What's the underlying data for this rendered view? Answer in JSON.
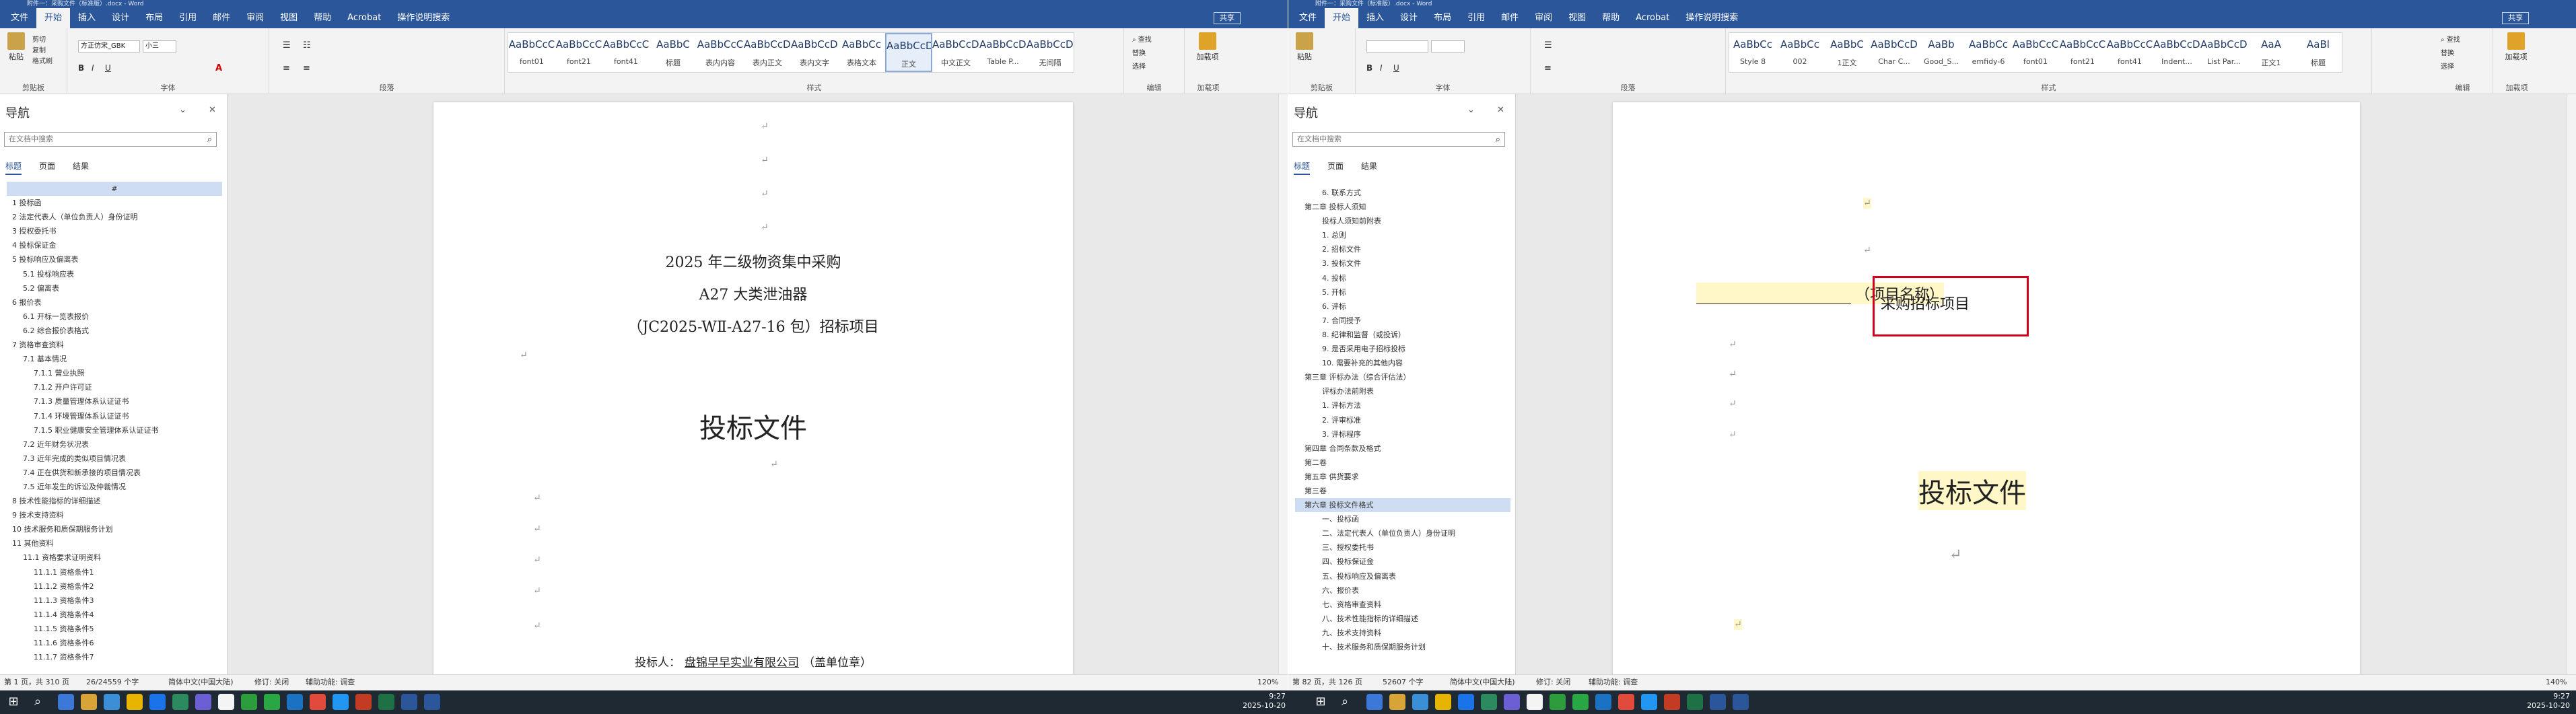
{
  "left": {
    "titlebar": {
      "title": "附件一：采购文件（标准版）.docx - Word"
    },
    "tabs": [
      "文件",
      "开始",
      "插入",
      "设计",
      "布局",
      "引用",
      "邮件",
      "审阅",
      "视图",
      "帮助",
      "Acrobat",
      "操作说明搜索"
    ],
    "share": "共享",
    "ribbon": {
      "clipboard": {
        "paste": "粘贴",
        "cut": "剪切",
        "copy": "复制",
        "format_painter": "格式刷",
        "label": "剪贴板"
      },
      "font": {
        "name": "方正仿宋_GBK",
        "size": "小三",
        "label": "字体"
      },
      "paragraph": {
        "label": "段落"
      },
      "styles": {
        "label": "样式",
        "items": [
          {
            "preview": "AaBbCcC",
            "name": "font01"
          },
          {
            "preview": "AaBbCcC",
            "name": "font21"
          },
          {
            "preview": "AaBbCcC",
            "name": "font41"
          },
          {
            "preview": "AaBbC",
            "name": "标题"
          },
          {
            "preview": "AaBbCcC",
            "name": "表内内容"
          },
          {
            "preview": "AaBbCcDd",
            "name": "表内正文"
          },
          {
            "preview": "AaBbCcDd",
            "name": "表内文字"
          },
          {
            "preview": "AaBbCc",
            "name": "表格文本"
          },
          {
            "preview": "AaBbCcDd",
            "name": "正文"
          },
          {
            "preview": "AaBbCcDd",
            "name": "中文正文"
          },
          {
            "preview": "AaBbCcDd",
            "name": "Table P..."
          },
          {
            "preview": "AaBbCcDd",
            "name": "无间隔"
          }
        ]
      },
      "editing": {
        "find": "查找",
        "replace": "替换",
        "select": "选择",
        "label": "编辑"
      },
      "addins": {
        "label": "加载项",
        "btn": "加载项"
      }
    },
    "nav": {
      "title": "导航",
      "search_placeholder": "在文档中搜索",
      "tabs": [
        "标题",
        "页面",
        "结果"
      ],
      "items": [
        "#",
        "1 投标函",
        "2 法定代表人（单位负责人）身份证明",
        "3 授权委托书",
        "4 投标保证金",
        "5 投标响应及偏离表",
        "5.1 投标响应表",
        "5.2 偏离表",
        "6 报价表",
        "6.1 开标一览表报价",
        "6.2 综合报价表格式",
        "7 资格审查资料",
        "7.1 基本情况",
        "7.1.1 营业执照",
        "7.1.2 开户许可证",
        "7.1.3 质量管理体系认证证书",
        "7.1.4 环境管理体系认证证书",
        "7.1.5 职业健康安全管理体系认证证书",
        "7.2 近年财务状况表",
        "7.3 近年完成的类似项目情况表",
        "7.4 正在供货和新承接的项目情况表",
        "7.5 近年发生的诉讼及仲裁情况",
        "8 技术性能指标的详细描述",
        "9 技术支持资料",
        "10 技术服务和质保期服务计划",
        "11 其他资料",
        "11.1 资格要求证明资料",
        "11.1.1 资格条件1",
        "11.1.2 资格条件2",
        "11.1.3 资格条件3",
        "11.1.4 资格条件4",
        "11.1.5 资格条件5",
        "11.1.6 资格条件6",
        "11.1.7 资格条件7"
      ]
    },
    "doc": {
      "line1": "2025 年二级物资集中采购",
      "line2": "A27 大类泄油器",
      "line3": "（JC2025-WⅡ-A27-16 包）招标项目",
      "line4": "投标文件",
      "line5_prefix": "投标人：",
      "line5_company": "盘锦早早实业有限公司",
      "line5_suffix": "（盖单位章）"
    },
    "status": {
      "page": "第 1 页，共 310 页",
      "words": "26/24559 个字",
      "lang": "简体中文(中国大陆)",
      "track": "修订: 关闭",
      "access": "辅助功能: 调查",
      "zoom": "120%"
    }
  },
  "right": {
    "titlebar": {
      "title": "附件一：采购文件（标准版）.docx - Word"
    },
    "tabs": [
      "文件",
      "开始",
      "插入",
      "设计",
      "布局",
      "引用",
      "邮件",
      "审阅",
      "视图",
      "帮助",
      "Acrobat",
      "操作说明搜索"
    ],
    "share": "共享",
    "ribbon": {
      "clipboard": {
        "paste": "粘贴",
        "label": "剪贴板"
      },
      "font": {
        "label": "字体"
      },
      "paragraph": {
        "label": "段落"
      },
      "styles": {
        "label": "样式",
        "items": [
          {
            "preview": "AaBbCc",
            "name": "Style 8"
          },
          {
            "preview": "AaBbCc",
            "name": "002"
          },
          {
            "preview": "AaBbC",
            "name": "1正文"
          },
          {
            "preview": "AaBbCcD",
            "name": "Char C..."
          },
          {
            "preview": "AaBb",
            "name": "Good_S..."
          },
          {
            "preview": "AaBbCc",
            "name": "emfidy-6"
          },
          {
            "preview": "AaBbCcC",
            "name": "font01"
          },
          {
            "preview": "AaBbCcC",
            "name": "font21"
          },
          {
            "preview": "AaBbCcC",
            "name": "font41"
          },
          {
            "preview": "AaBbCcDd",
            "name": "Indent..."
          },
          {
            "preview": "AaBbCcDd",
            "name": "List Par..."
          },
          {
            "preview": "AaA",
            "name": "正文1"
          },
          {
            "preview": "AaBl",
            "name": "标题"
          }
        ]
      },
      "editing": {
        "find": "查找",
        "replace": "替换",
        "select": "选择",
        "label": "编辑"
      },
      "addins": {
        "label": "加载项",
        "btn": "加载项"
      }
    },
    "nav": {
      "title": "导航",
      "search_placeholder": "在文档中搜索",
      "tabs": [
        "标题",
        "页面",
        "结果"
      ],
      "items": [
        "6. 联系方式",
        "第二章  投标人须知",
        "投标人须知前附表",
        "1. 总则",
        "2. 招标文件",
        "3. 投标文件",
        "4. 投标",
        "5. 开标",
        "6. 评标",
        "7. 合同授予",
        "8. 纪律和监督（或投诉）",
        "9. 是否采用电子招标投标",
        "10. 需要补充的其他内容",
        "第三章  评标办法（综合评估法）",
        "评标办法前附表",
        "1. 评标方法",
        "2. 评审标准",
        "3. 评标程序",
        "第四章  合同条款及格式",
        "第二卷",
        "第五章  供货要求",
        "第三卷",
        "第六章  投标文件格式",
        "一、投标函",
        "二、法定代表人（单位负责人）身份证明",
        "三、授权委托书",
        "四、投标保证金",
        "五、投标响应及偏离表",
        "六、报价表",
        "七、资格审查资料",
        "八、技术性能指标的详细描述",
        "九、技术支持资料",
        "十、技术服务和质保期服务计划"
      ],
      "selected_index": 22
    },
    "doc": {
      "project_label": "（项目名称）",
      "project_name": "采购招标项目",
      "title": "投标文件"
    },
    "status": {
      "page": "第 82 页，共 126 页",
      "words": "52607 个字",
      "lang": "简体中文(中国大陆)",
      "track": "修订: 关闭",
      "access": "辅助功能: 调查",
      "zoom": "140%"
    }
  },
  "taskbar": {
    "left_clock": {
      "time": "9:27",
      "date": "2025-10-20"
    },
    "right_clock": {
      "time": "9:27",
      "date": "2025-10-20"
    }
  }
}
